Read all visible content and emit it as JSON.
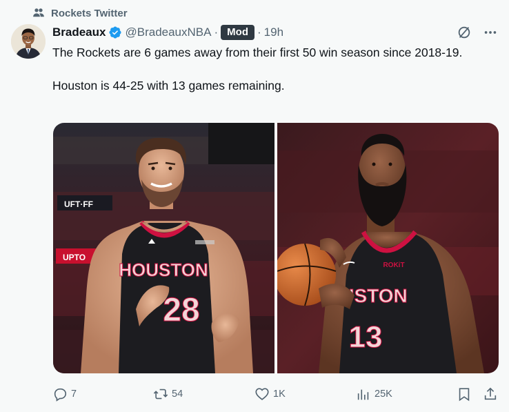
{
  "community": {
    "label": "Rockets Twitter",
    "icon": "community-icon"
  },
  "author": {
    "display_name": "Bradeaux",
    "handle": "@BradeauxNBA",
    "separator": "·",
    "badge": "Mod",
    "time": "19h",
    "verified": true
  },
  "tweet": {
    "paragraph1": "The Rockets are 6 games away from their first 50 win season since 2018-19.",
    "paragraph2": "Houston is 44-25 with 13 games remaining."
  },
  "media": {
    "photo1": {
      "jersey_text": "HOUSTON",
      "number": "28",
      "arena_sign": "UFT·FF",
      "arena_sign2": "UPTO"
    },
    "photo2": {
      "jersey_text": "USTON",
      "number": "13",
      "chest_patch": "ROKiT"
    }
  },
  "actions": {
    "replies": "7",
    "reposts": "54",
    "likes": "1K",
    "views": "25K"
  },
  "colors": {
    "accent_blue": "#1d9bf0",
    "muted_text": "#536471",
    "rockets_red": "#ce1141",
    "jersey_black": "#1c1c20"
  }
}
